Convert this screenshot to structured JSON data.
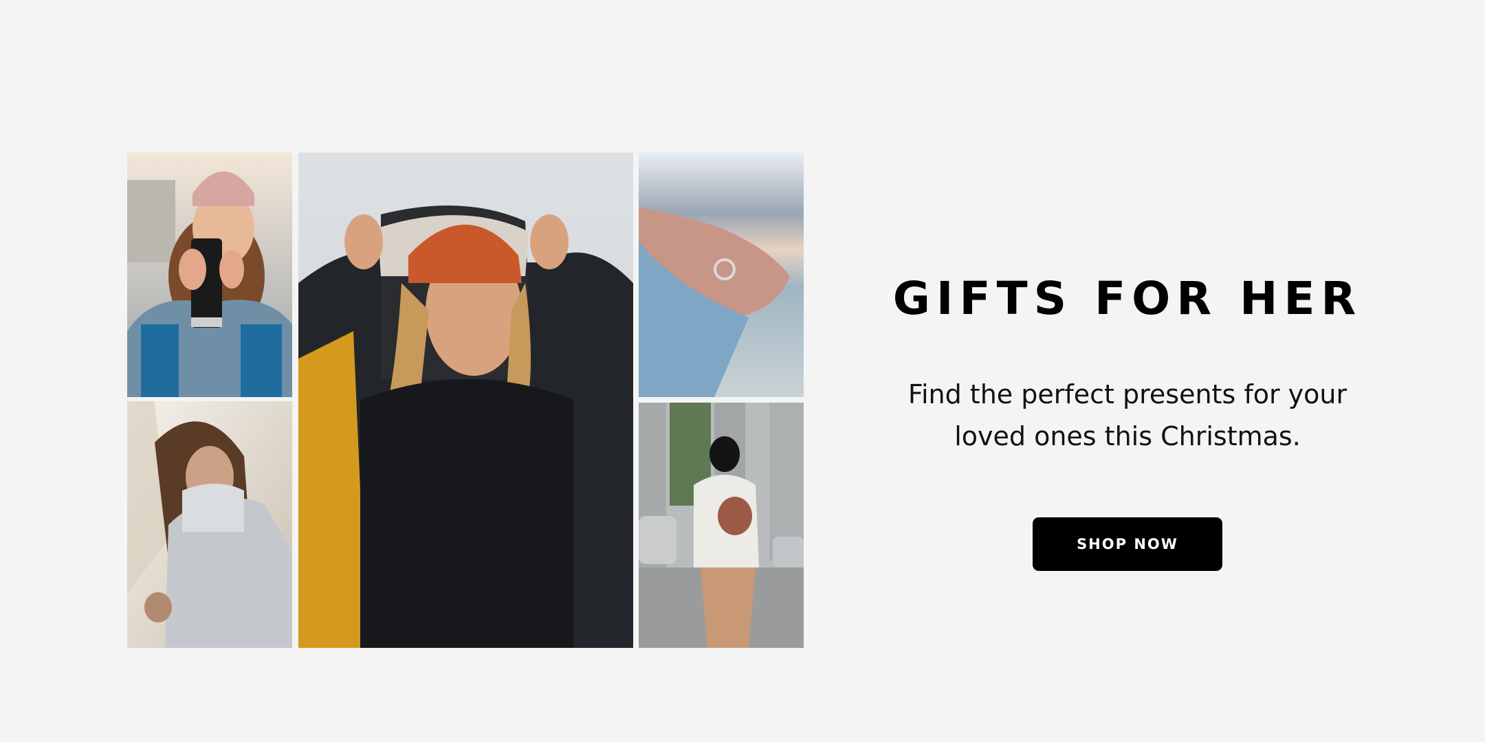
{
  "banner": {
    "title": "GIFTS FOR HER",
    "subtitle": "Find the perfect presents for your loved ones this Christmas.",
    "cta_label": "SHOP NOW"
  },
  "colors": {
    "background": "#f4f4f4",
    "title": "#000000",
    "button_bg": "#000000",
    "button_text": "#ffffff"
  },
  "gallery": {
    "photos": [
      {
        "name": "woman-beanie-tumbler-photo"
      },
      {
        "name": "woman-puffer-jacket-photo"
      },
      {
        "name": "woman-hooded-jacket-beanie-photo"
      },
      {
        "name": "hand-ring-beach-photo"
      },
      {
        "name": "person-walking-crossbody-bag-photo"
      }
    ]
  }
}
